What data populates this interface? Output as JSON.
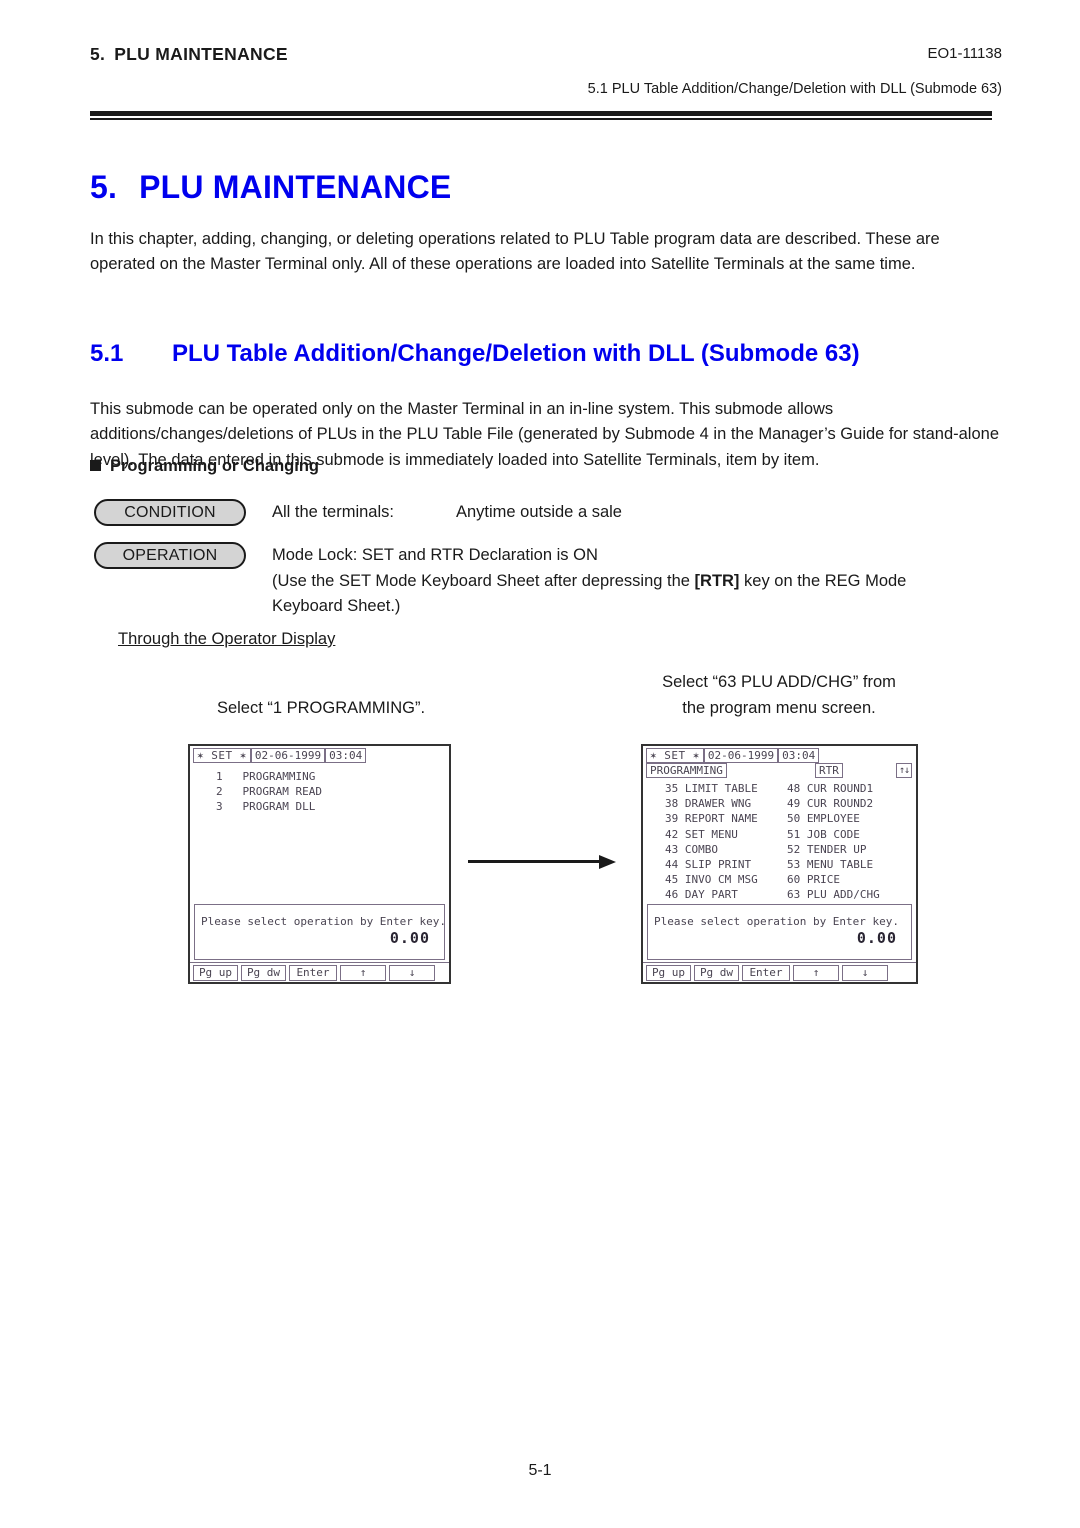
{
  "header": {
    "section_number": "5.",
    "section_title": "PLU MAINTENANCE",
    "doc_number": "EO1-11138",
    "subheader": "5.1  PLU Table Addition/Change/Deletion with DLL (Submode 63)"
  },
  "chapter": {
    "number": "5.",
    "title": "PLU MAINTENANCE",
    "intro": "In this chapter, adding, changing, or deleting operations related to PLU Table program data are described. These are operated on the Master Terminal only. All of these operations are loaded into Satellite Terminals at the same time."
  },
  "section": {
    "number": "5.1",
    "title": "PLU Table Addition/Change/Deletion with DLL (Submode 63)",
    "body": "This submode can be operated only on the Master Terminal in an in-line system. This submode allows additions/changes/deletions of PLUs in the PLU Table File (generated by Submode 4 in the Manager’s Guide for stand-alone level). The data entered in this submode is immediately loaded into Satellite Terminals, item by item.",
    "sub_heading": "Programming or Changing"
  },
  "condition": {
    "badge_label": "CONDITION",
    "text_1": "All the terminals:",
    "text_2": "Anytime outside a sale"
  },
  "operation": {
    "badge_label": "OPERATION",
    "line_1": "Mode Lock:  SET and RTR Declaration is ON",
    "line_2_a": "(Use the SET Mode Keyboard Sheet after depressing the ",
    "line_2_key": "[RTR]",
    "line_2_b": " key on the REG Mode",
    "line_3": "Keyboard Sheet.)"
  },
  "operator_display_heading": "Through the Operator Display",
  "captions": {
    "left": "Select “1 PROGRAMMING”.",
    "right_line1": "Select “63 PLU ADD/CHG” from",
    "right_line2": "the program menu screen."
  },
  "screen_left": {
    "mode": "✶ SET ✶",
    "date": "02-06-1999",
    "time": "03:04",
    "menu_items": [
      "1   PROGRAMMING",
      "2   PROGRAM READ",
      "3   PROGRAM DLL"
    ],
    "message": "Please select operation by Enter key.",
    "amount": "0.00",
    "keys": [
      "Pg up",
      "Pg dw",
      "Enter",
      "↑",
      "↓"
    ]
  },
  "screen_right": {
    "mode": "✶ SET ✶",
    "date": "02-06-1999",
    "time": "03:04",
    "mode_label": "PROGRAMMING",
    "rtr_label": "RTR",
    "scroll_icon": "↑↓",
    "menu_rows": [
      {
        "left": "35 LIMIT TABLE",
        "right": "48 CUR ROUND1"
      },
      {
        "left": "38 DRAWER WNG",
        "right": "49 CUR ROUND2"
      },
      {
        "left": "39 REPORT NAME",
        "right": "50 EMPLOYEE"
      },
      {
        "left": "42 SET MENU",
        "right": "51 JOB CODE"
      },
      {
        "left": "43 COMBO",
        "right": "52 TENDER UP"
      },
      {
        "left": "44 SLIP PRINT",
        "right": "53 MENU TABLE"
      },
      {
        "left": "45 INVO CM MSG",
        "right": "60 PRICE"
      },
      {
        "left": "46 DAY PART",
        "right": "63 PLU ADD/CHG"
      }
    ],
    "message": "Please select operation by Enter key.",
    "amount": "0.00",
    "keys": [
      "Pg up",
      "Pg dw",
      "Enter",
      "↑",
      "↓"
    ]
  },
  "footer": {
    "page_number": "5-1"
  },
  "colors": {
    "heading_blue": "#0000ee",
    "badge_fill": "#d4d4d4",
    "screen_text": "#4a4452"
  }
}
